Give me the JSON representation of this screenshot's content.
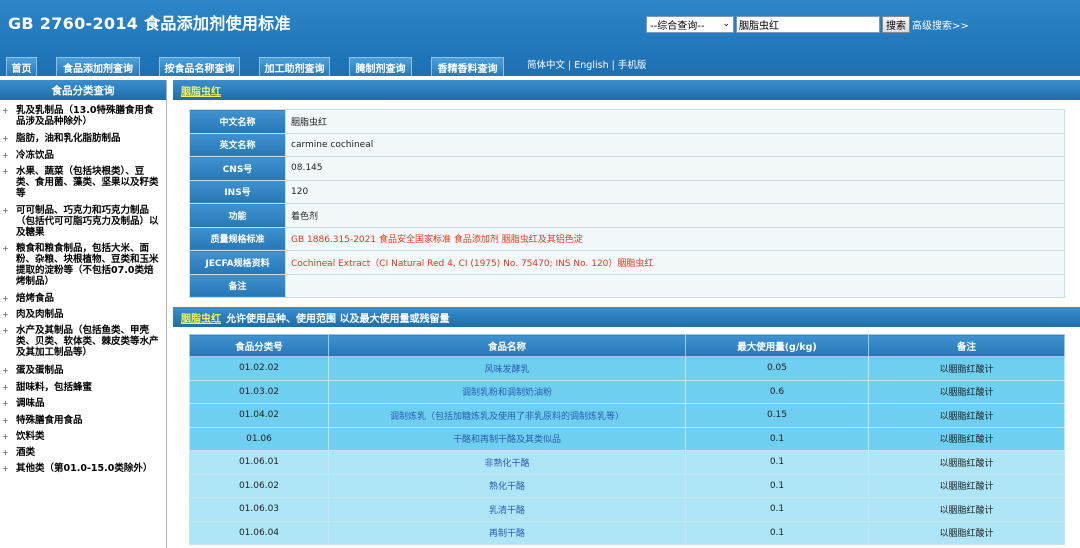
{
  "header": {
    "site_title": "GB 2760-2014 食品添加剂使用标准",
    "search_select": "--综合查询--",
    "search_value": "胭脂虫红",
    "search_button": "搜索",
    "advanced_search": "高级搜索>>"
  },
  "nav": {
    "tabs": [
      "首页",
      "食品添加剂查询",
      "按食品名称查询",
      "加工助剂查询",
      "腌制剂查询",
      "香精香料查询"
    ],
    "lang_cn": "简体中文",
    "lang_en": "English",
    "lang_mobile": "手机版",
    "separator": "|"
  },
  "sidebar": {
    "title": "食品分类查询",
    "items": [
      "乳及乳制品（13.0特殊膳食用食品涉及品种除外）",
      "脂肪，油和乳化脂肪制品",
      "冷冻饮品",
      "水果、蔬菜（包括块根类）、豆类、食用菌、藻类、坚果以及籽类等",
      "可可制品、巧克力和巧克力制品（包括代可可脂巧克力及制品）以及糖果",
      "粮食和粮食制品，包括大米、面粉、杂粮、块根植物、豆类和玉米提取的淀粉等（不包括07.0类焙烤制品）",
      "焙烤食品",
      "肉及肉制品",
      "水产及其制品（包括鱼类、甲壳类、贝类、软体类、棘皮类等水产及其加工制品等）",
      "蛋及蛋制品",
      "甜味料，包括蜂蜜",
      "调味品",
      "特殊膳食用食品",
      "饮料类",
      "酒类",
      "其他类（第01.0-15.0类除外）"
    ],
    "expand_symbol": "+"
  },
  "main": {
    "section1_title": "胭脂虫红",
    "section2_title_highlight": "胭脂虫红",
    "section2_title_rest": "允许使用品种、使用范围 以及最大使用量或残留量",
    "info": [
      {
        "label": "中文名称",
        "value": "胭脂虫红"
      },
      {
        "label": "英文名称",
        "value": "carmine cochineal"
      },
      {
        "label": "CNS号",
        "value": "08.145"
      },
      {
        "label": "INS号",
        "value": "120"
      },
      {
        "label": "功能",
        "value": "着色剂"
      },
      {
        "label": "质量规格标准",
        "value": "GB 1886.315-2021 食品安全国家标准 食品添加剂 胭脂虫红及其铝色淀"
      },
      {
        "label": "JECFA规格资料",
        "value": "Cochineal Extract（CI Natural Red 4, CI (1975) No. 75470; INS No. 120）胭脂虫红"
      },
      {
        "label": "备注",
        "value": ""
      }
    ],
    "usage_headers": [
      "食品分类号",
      "食品名称",
      "最大使用量(g/kg)",
      "备注"
    ],
    "usage_rows": [
      {
        "code": "01.02.02",
        "name": "风味发酵乳",
        "max": "0.05",
        "note": "以胭脂红酸计"
      },
      {
        "code": "01.03.02",
        "name": "调制乳粉和调制奶油粉",
        "max": "0.6",
        "note": "以胭脂红酸计"
      },
      {
        "code": "01.04.02",
        "name": "调制炼乳（包括加糖炼乳及使用了非乳原料的调制炼乳等）",
        "max": "0.15",
        "note": "以胭脂红酸计"
      },
      {
        "code": "01.06",
        "name": "干酪和再制干酪及其类似品",
        "max": "0.1",
        "note": "以胭脂红酸计"
      },
      {
        "code": "01.06.01",
        "name": "非熟化干酪",
        "max": "0.1",
        "note": "以胭脂红酸计"
      },
      {
        "code": "01.06.02",
        "name": "熟化干酪",
        "max": "0.1",
        "note": "以胭脂红酸计"
      },
      {
        "code": "01.06.03",
        "name": "乳清干酪",
        "max": "0.1",
        "note": "以胭脂红酸计"
      },
      {
        "code": "01.06.04",
        "name": "再制干酪",
        "max": "0.1",
        "note": "以胭脂红酸计"
      }
    ]
  }
}
